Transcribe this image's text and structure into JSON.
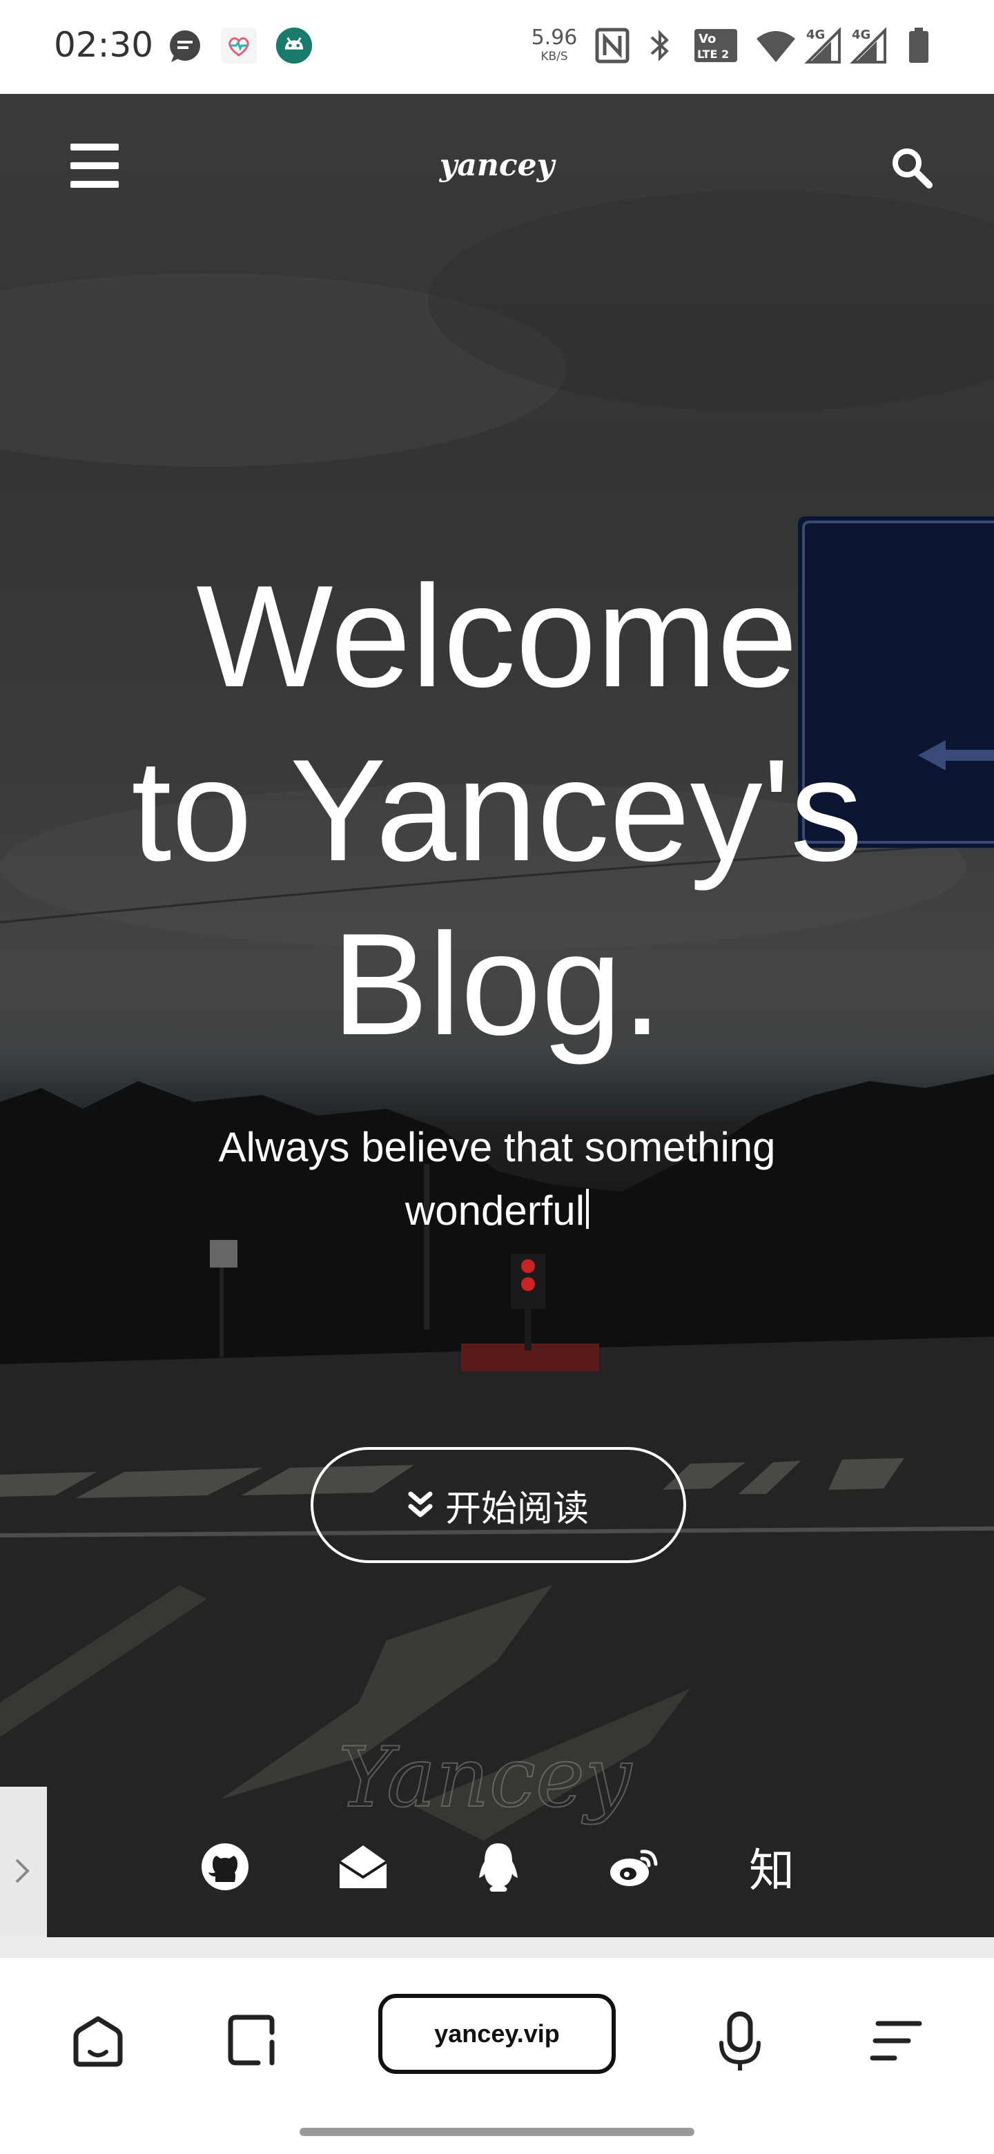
{
  "status_bar": {
    "time": "02:30",
    "net_speed_value": "5.96",
    "net_speed_unit": "KB/S",
    "icons": [
      "message-icon",
      "heart-app-icon",
      "android-icon",
      "nfc-icon",
      "bluetooth-icon",
      "volte-icon",
      "wifi-icon",
      "signal-4g-icon",
      "signal-4g-icon",
      "battery-icon"
    ],
    "volte_line1": "Vo",
    "volte_line2": "LTE 2",
    "sig1": "4G",
    "sig2": "4G"
  },
  "header": {
    "brand": "yancey",
    "menu_icon": "hamburger-menu-icon",
    "search_icon": "search-icon"
  },
  "hero": {
    "title_line1": "Welcome",
    "title_line2": "to Yancey's",
    "title_line3": "Blog.",
    "subtitle_line1": "Always believe that something",
    "subtitle_line2": "wonderful",
    "cta_label": "开始阅读",
    "cta_icon": "double-chevron-down-icon",
    "signature_text": "Yancey"
  },
  "social": {
    "items": [
      "github-icon",
      "mail-icon",
      "qq-icon",
      "weibo-icon",
      "zhihu-icon"
    ],
    "zhihu_glyph": "知"
  },
  "browser_bar": {
    "url": "yancey.vip",
    "icons": [
      "home-icon",
      "tabs-icon",
      "microphone-icon",
      "menu-icon"
    ]
  },
  "colors": {
    "hero_text": "#ffffff",
    "statusbar_bg": "#ffffff",
    "bottombar_bg": "#ffffff"
  }
}
